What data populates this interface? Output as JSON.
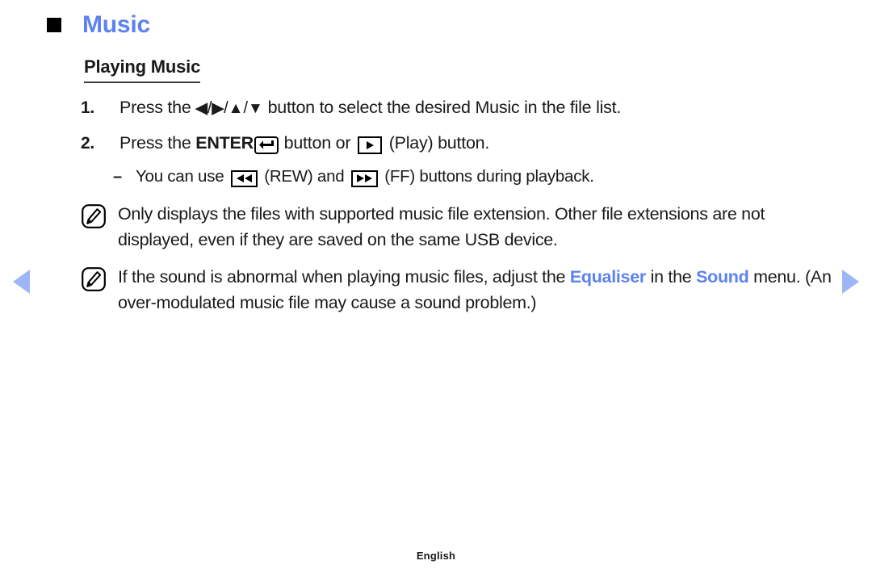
{
  "nav": {
    "prev_label": "previous page",
    "next_label": "next page",
    "arrow_color": "#9db6f5"
  },
  "section": {
    "bullet": "square-bullet",
    "title": "Music",
    "title_color": "#5c82f0"
  },
  "subsection": {
    "title": "Playing Music"
  },
  "steps": [
    {
      "number": "1.",
      "text_before": "Press the ",
      "keys": "◀/▶/▲/▼",
      "key_parts": [
        "◀",
        "/",
        "▶",
        "/",
        "▲",
        "/",
        "▼"
      ],
      "text_after": " button to select the desired Music in the file list."
    },
    {
      "number": "2.",
      "text_before": "Press the ",
      "key_label": "ENTER",
      "key_icon": "enter-key-icon",
      "text_middle": " button or ",
      "play_icon": "play-key-icon",
      "text_after": " (Play) button."
    }
  ],
  "dash_item": {
    "mark": "–",
    "text_before": "You can use ",
    "rew_icon": "rewind-key-icon",
    "text_middle_1": " (REW) and ",
    "ff_icon": "fast-forward-key-icon",
    "text_after": " (FF) buttons during playback."
  },
  "notes": [
    {
      "icon": "note-pencil-icon",
      "text": "Only displays the files with supported music file extension. Other file extensions are not displayed, even if they are saved on the same USB device."
    },
    {
      "icon": "note-pencil-icon",
      "text_part_1": "If the sound is abnormal when playing music files, adjust the ",
      "link_1": "Equaliser",
      "text_part_2": " in the ",
      "link_2": "Sound",
      "text_part_3": " menu. (An over-modulated music file may cause a sound problem.)"
    }
  ],
  "footer": {
    "language": "English"
  }
}
